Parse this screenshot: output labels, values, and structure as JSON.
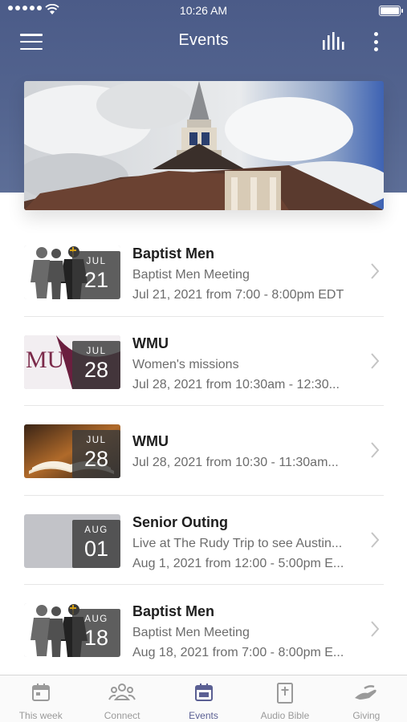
{
  "status_bar": {
    "time": "10:26 AM"
  },
  "nav": {
    "title": "Events"
  },
  "colors": {
    "header": "#4b5b88",
    "active_tab": "#5a5f93",
    "inactive_tab": "#9a9a9a"
  },
  "banner": {
    "image": "church-steeple-clouds"
  },
  "events": [
    {
      "title": "Baptist Men",
      "subtitle": "Baptist Men Meeting",
      "when": "Jul 21, 2021 from 7:00 - 8:00pm EDT",
      "month": "JUL",
      "day": "21",
      "thumb": "men-silhouettes"
    },
    {
      "title": "WMU",
      "subtitle": "Women's missions",
      "when": "Jul 28, 2021 from 10:30am - 12:30...",
      "month": "JUL",
      "day": "28",
      "thumb": "wmu-logo"
    },
    {
      "title": "WMU",
      "subtitle": "",
      "when": "Jul 28, 2021 from 10:30 - 11:30am...",
      "month": "JUL",
      "day": "28",
      "thumb": "open-bible"
    },
    {
      "title": "Senior Outing",
      "subtitle": "Live at The Rudy Trip to see Austin...",
      "when": "Aug 1, 2021 from 12:00 - 5:00pm E...",
      "month": "AUG",
      "day": "01",
      "thumb": "blank-gray"
    },
    {
      "title": "Baptist Men",
      "subtitle": "Baptist Men Meeting",
      "when": "Aug 18, 2021 from 7:00 - 8:00pm E...",
      "month": "AUG",
      "day": "18",
      "thumb": "men-silhouettes"
    }
  ],
  "tabs": [
    {
      "label": "This week",
      "icon": "calendar-icon",
      "active": false
    },
    {
      "label": "Connect",
      "icon": "people-icon",
      "active": false
    },
    {
      "label": "Events",
      "icon": "calendar-icon",
      "active": true
    },
    {
      "label": "Audio Bible",
      "icon": "bible-icon",
      "active": false
    },
    {
      "label": "Giving",
      "icon": "giving-hand-icon",
      "active": false
    }
  ]
}
